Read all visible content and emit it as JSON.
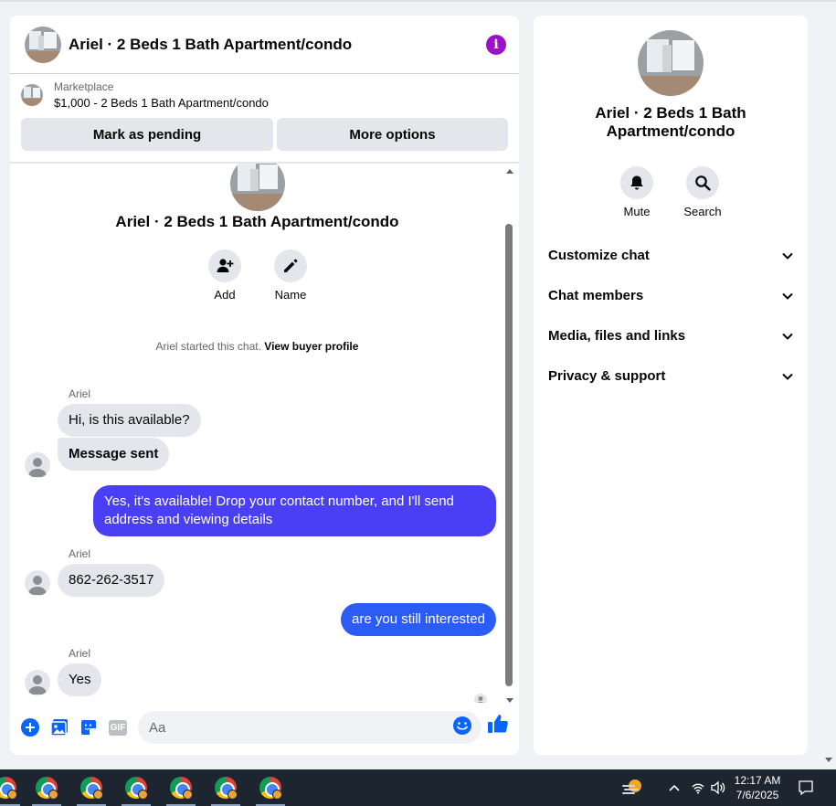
{
  "chat": {
    "title": "Ariel · 2 Beds 1 Bath Apartment/condo",
    "listing": {
      "source": "Marketplace",
      "price_title": "$1,000 - 2 Beds 1 Bath Apartment/condo"
    },
    "actions": {
      "mark_pending": "Mark as pending",
      "more_options": "More options"
    },
    "intro": {
      "title": "Ariel · 2 Beds 1 Bath Apartment/condo",
      "add_label": "Add",
      "name_label": "Name"
    },
    "system_note": {
      "text": "Ariel started this chat.",
      "link": "View buyer profile"
    },
    "messages": [
      {
        "sender": "Ariel",
        "text": "Hi, is this available?"
      },
      {
        "text": "Message sent"
      },
      {
        "text": "Yes, it's available! Drop your contact number, and I'll send address and viewing details"
      },
      {
        "sender": "Ariel",
        "text": "862-262-3517"
      },
      {
        "text": "are you still interested"
      },
      {
        "sender": "Ariel",
        "text": "Yes"
      }
    ],
    "composer": {
      "placeholder": "Aa",
      "gif_label": "GIF"
    }
  },
  "details": {
    "title": "Ariel · 2 Beds 1 Bath Apartment/condo",
    "mute_label": "Mute",
    "search_label": "Search",
    "sections": [
      "Customize chat",
      "Chat members",
      "Media, files and links",
      "Privacy & support"
    ]
  },
  "taskbar": {
    "time": "12:17 AM",
    "date": "7/6/2025"
  },
  "colors": {
    "outgoing_bubble": "#4a3ff5",
    "outgoing_bubble_alt": "#2b5cf5",
    "accent": "#0866ff",
    "info": "#9b11c8"
  }
}
